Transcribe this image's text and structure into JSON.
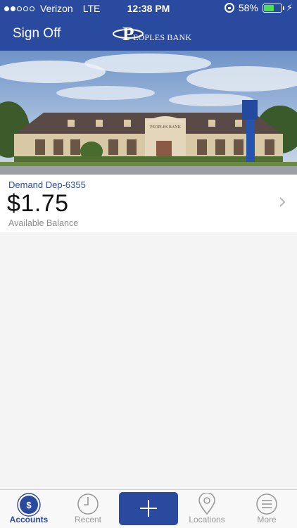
{
  "status_bar": {
    "carrier": "Verizon",
    "network": "LTE",
    "time": "12:38 PM",
    "battery": "58%",
    "battery_level": 0.58,
    "signal_bars": 2,
    "signal_total": 5
  },
  "nav": {
    "signoff_label": "Sign Off",
    "logo_text": "EOPLES BANK",
    "logo_letter": "P"
  },
  "account": {
    "name": "Demand Dep-6355",
    "balance": "$1.75",
    "balance_label": "Available Balance"
  },
  "tabs": {
    "accounts": "Accounts",
    "recent": "Recent",
    "locations": "Locations",
    "more": "More",
    "accounts_glyph": "$"
  },
  "colors": {
    "brand_blue": "#2a4aa0",
    "tab_inactive": "#9a9a9a",
    "battery_green": "#4ce04c"
  },
  "icons": [
    "signal-dots-icon",
    "rotation-lock-icon",
    "battery-icon",
    "charging-bolt-icon",
    "chevron-right-icon",
    "accounts-dollar-icon",
    "recent-clock-icon",
    "plus-icon",
    "location-pin-icon",
    "more-menu-icon"
  ]
}
